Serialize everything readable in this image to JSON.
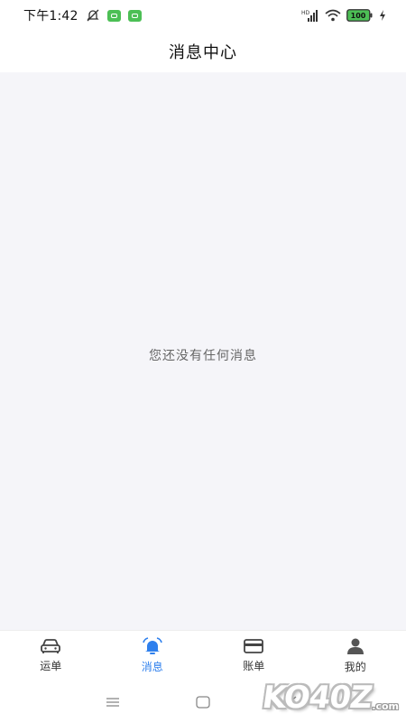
{
  "status_bar": {
    "time": "下午1:42",
    "network_label": "HD",
    "battery": "100"
  },
  "header": {
    "title": "消息中心"
  },
  "main": {
    "empty_message": "您还没有任何消息"
  },
  "tabs": [
    {
      "label": "运单",
      "icon": "car-icon",
      "active": false
    },
    {
      "label": "消息",
      "icon": "bell-icon",
      "active": true
    },
    {
      "label": "账单",
      "icon": "card-icon",
      "active": false
    },
    {
      "label": "我的",
      "icon": "user-icon",
      "active": false
    }
  ],
  "watermark": {
    "text": "KO40Z",
    "suffix": ".com"
  },
  "colors": {
    "accent": "#2f80ed",
    "background": "#f5f5f9",
    "badge_green": "#4cbf55"
  }
}
